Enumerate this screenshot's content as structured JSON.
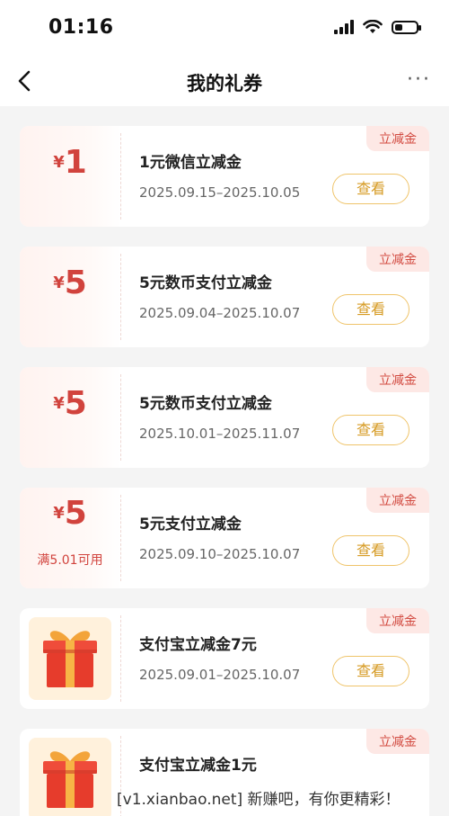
{
  "status": {
    "time": "01:16"
  },
  "nav": {
    "title": "我的礼券",
    "more": "···"
  },
  "coupons": [
    {
      "tag": "立减金",
      "yen": "¥",
      "amount": "1",
      "condition": "",
      "name": "1元微信立减金",
      "date": "2025.09.15–2025.10.05",
      "button": "查看"
    },
    {
      "tag": "立减金",
      "yen": "¥",
      "amount": "5",
      "condition": "",
      "name": "5元数币支付立减金",
      "date": "2025.09.04–2025.10.07",
      "button": "查看"
    },
    {
      "tag": "立减金",
      "yen": "¥",
      "amount": "5",
      "condition": "",
      "name": "5元数币支付立减金",
      "date": "2025.10.01–2025.11.07",
      "button": "查看"
    },
    {
      "tag": "立减金",
      "yen": "¥",
      "amount": "5",
      "condition": "满5.01可用",
      "name": "5元支付立减金",
      "date": "2025.09.10–2025.10.07",
      "button": "查看"
    },
    {
      "tag": "立减金",
      "name": "支付宝立减金7元",
      "date": "2025.09.01–2025.10.07",
      "button": "查看",
      "icon": "gift-box-icon"
    },
    {
      "tag": "立减金",
      "name": "支付宝立减金1元",
      "date": "",
      "button": "",
      "icon": "gift-box-icon"
    }
  ],
  "watermark": "[v1.xianbao.net] 新赚吧，有你更精彩！",
  "colors": {
    "accent_red": "#d1433d",
    "button_gold": "#efc46a",
    "tag_bg": "#fde8e5"
  }
}
